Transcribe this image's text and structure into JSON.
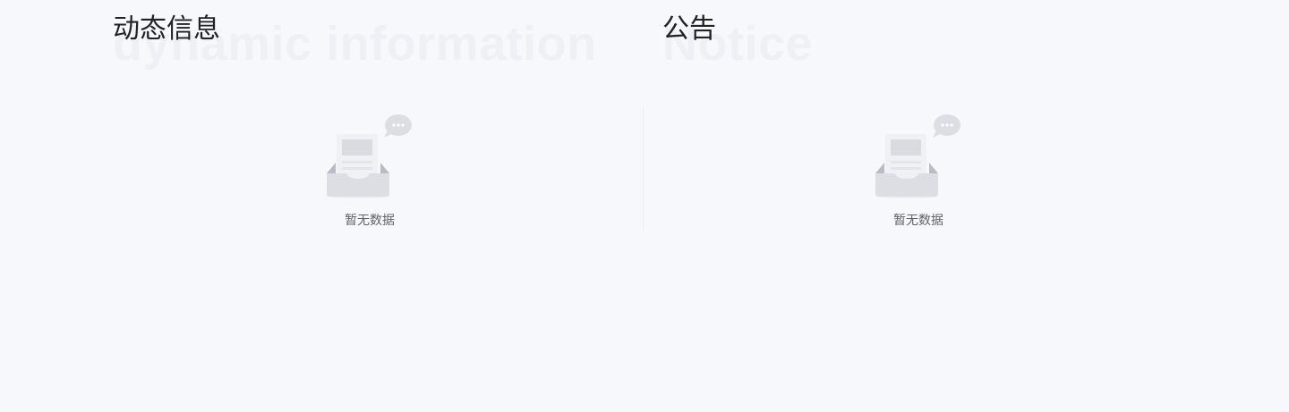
{
  "dynamic": {
    "title": "动态信息",
    "title_bg": "dynamic information",
    "empty_icon": "empty-inbox-icon",
    "empty_text": "暂无数据"
  },
  "notice": {
    "title": "公告",
    "title_bg": "Notice",
    "empty_icon": "empty-inbox-icon",
    "empty_text": "暂无数据"
  },
  "colors": {
    "background": "#f7f8fb",
    "title": "#222222",
    "watermark": "#eef0f5",
    "muted_text": "#606266"
  }
}
